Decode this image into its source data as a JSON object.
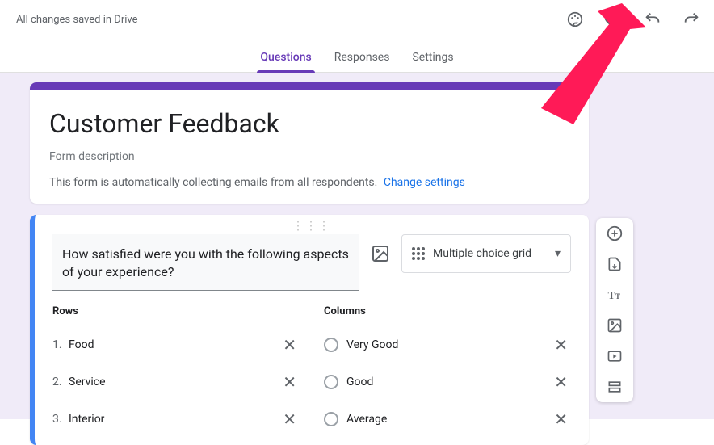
{
  "topbar": {
    "save_status": "All changes saved in Drive"
  },
  "tabs": {
    "questions": "Questions",
    "responses": "Responses",
    "settings": "Settings"
  },
  "form": {
    "title": "Customer Feedback",
    "description": "Form description",
    "notice_text": "This form is automatically collecting emails from all respondents.",
    "notice_link": "Change settings"
  },
  "question": {
    "title": "How satisfied were you with the following aspects of your experience?",
    "type_label": "Multiple choice grid",
    "rows_header": "Rows",
    "columns_header": "Columns",
    "rows": [
      {
        "num": "1.",
        "label": "Food"
      },
      {
        "num": "2.",
        "label": "Service"
      },
      {
        "num": "3.",
        "label": "Interior"
      }
    ],
    "columns": [
      {
        "label": "Very Good"
      },
      {
        "label": "Good"
      },
      {
        "label": "Average"
      }
    ]
  }
}
